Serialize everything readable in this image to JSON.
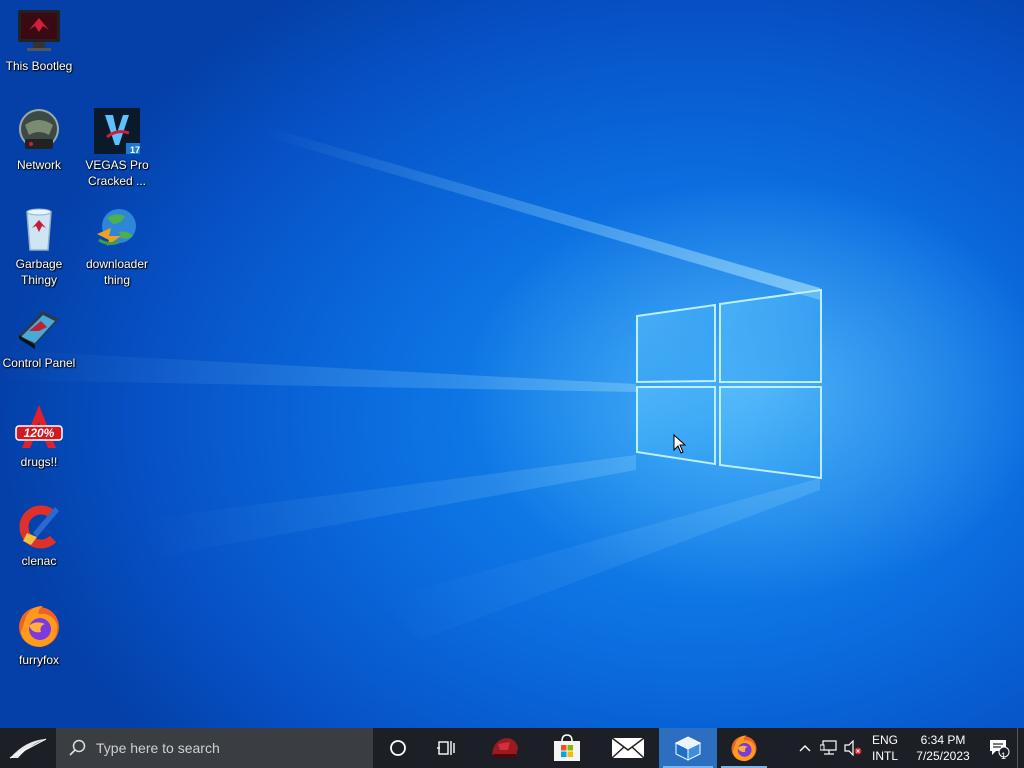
{
  "desktop": {
    "icons": [
      {
        "label": "This Bootleg"
      },
      {
        "label": "Network"
      },
      {
        "label": "VEGAS Pro Cracked ..."
      },
      {
        "label": "Garbage Thingy"
      },
      {
        "label": "downloader thing"
      },
      {
        "label": "Control Panel"
      },
      {
        "label": "drugs!!"
      },
      {
        "label": "clenac"
      },
      {
        "label": "furryfox"
      }
    ],
    "vegas_badge": "17",
    "logo_120_text": "120%"
  },
  "taskbar": {
    "search_placeholder": "Type here to search",
    "icons": [
      "start-icon",
      "search-icon",
      "cortana-icon",
      "task-view-icon",
      "app-icon",
      "store-icon",
      "mail-icon",
      "sandbox-icon",
      "firefox-icon"
    ],
    "language_line1": "ENG",
    "language_line2": "INTL",
    "time": "6:34 PM",
    "date": "7/25/2023",
    "notification_count": "1"
  },
  "colors": {
    "taskbar_bg": "#1c1f26",
    "search_bg": "#3a3d42",
    "active_app": "#2c6fc0",
    "desktop_blue": "#0b6ee0"
  }
}
